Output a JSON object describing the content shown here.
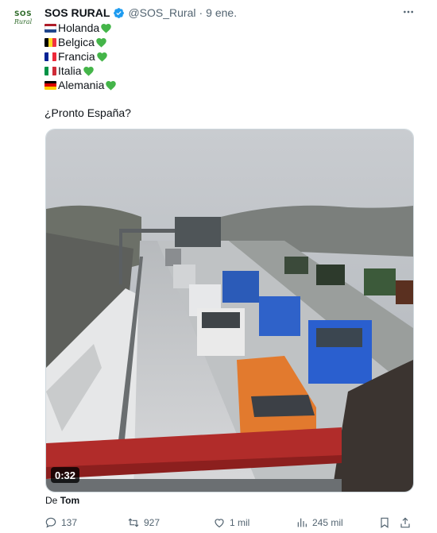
{
  "account": {
    "avatar_line1": "SOS",
    "avatar_line2": "Rural",
    "display_name": "SOS RURAL",
    "handle": "@SOS_Rural",
    "separator": "·",
    "time": "9 ene."
  },
  "tweet": {
    "lines": [
      {
        "country": "Holanda",
        "flag_colors": [
          "#ae1c28",
          "#ffffff",
          "#21468b"
        ],
        "flag_orientation": "horizontal"
      },
      {
        "country": "Belgica",
        "flag_colors": [
          "#000000",
          "#fdda24",
          "#ef3340"
        ],
        "flag_orientation": "vertical"
      },
      {
        "country": "Francia",
        "flag_colors": [
          "#002395",
          "#ffffff",
          "#ed2939"
        ],
        "flag_orientation": "vertical"
      },
      {
        "country": "Italia",
        "flag_colors": [
          "#009246",
          "#ffffff",
          "#ce2b37"
        ],
        "flag_orientation": "vertical"
      },
      {
        "country": "Alemania",
        "flag_colors": [
          "#000000",
          "#dd0000",
          "#ffce00"
        ],
        "flag_orientation": "horizontal"
      }
    ],
    "heart_emoji_color": "#44b549",
    "question": "¿Pronto España?"
  },
  "media": {
    "type": "video",
    "description_icon": "video-thumbnail",
    "duration": "0:32",
    "attribution_prefix": "De",
    "attribution_name": "Tom"
  },
  "actions": {
    "replies": "137",
    "retweets": "927",
    "likes": "1 mil",
    "views": "245 mil"
  },
  "colors": {
    "verified": "#1d9bf0",
    "secondary_text": "#536471",
    "avatar_green": "#2f6b2a"
  }
}
